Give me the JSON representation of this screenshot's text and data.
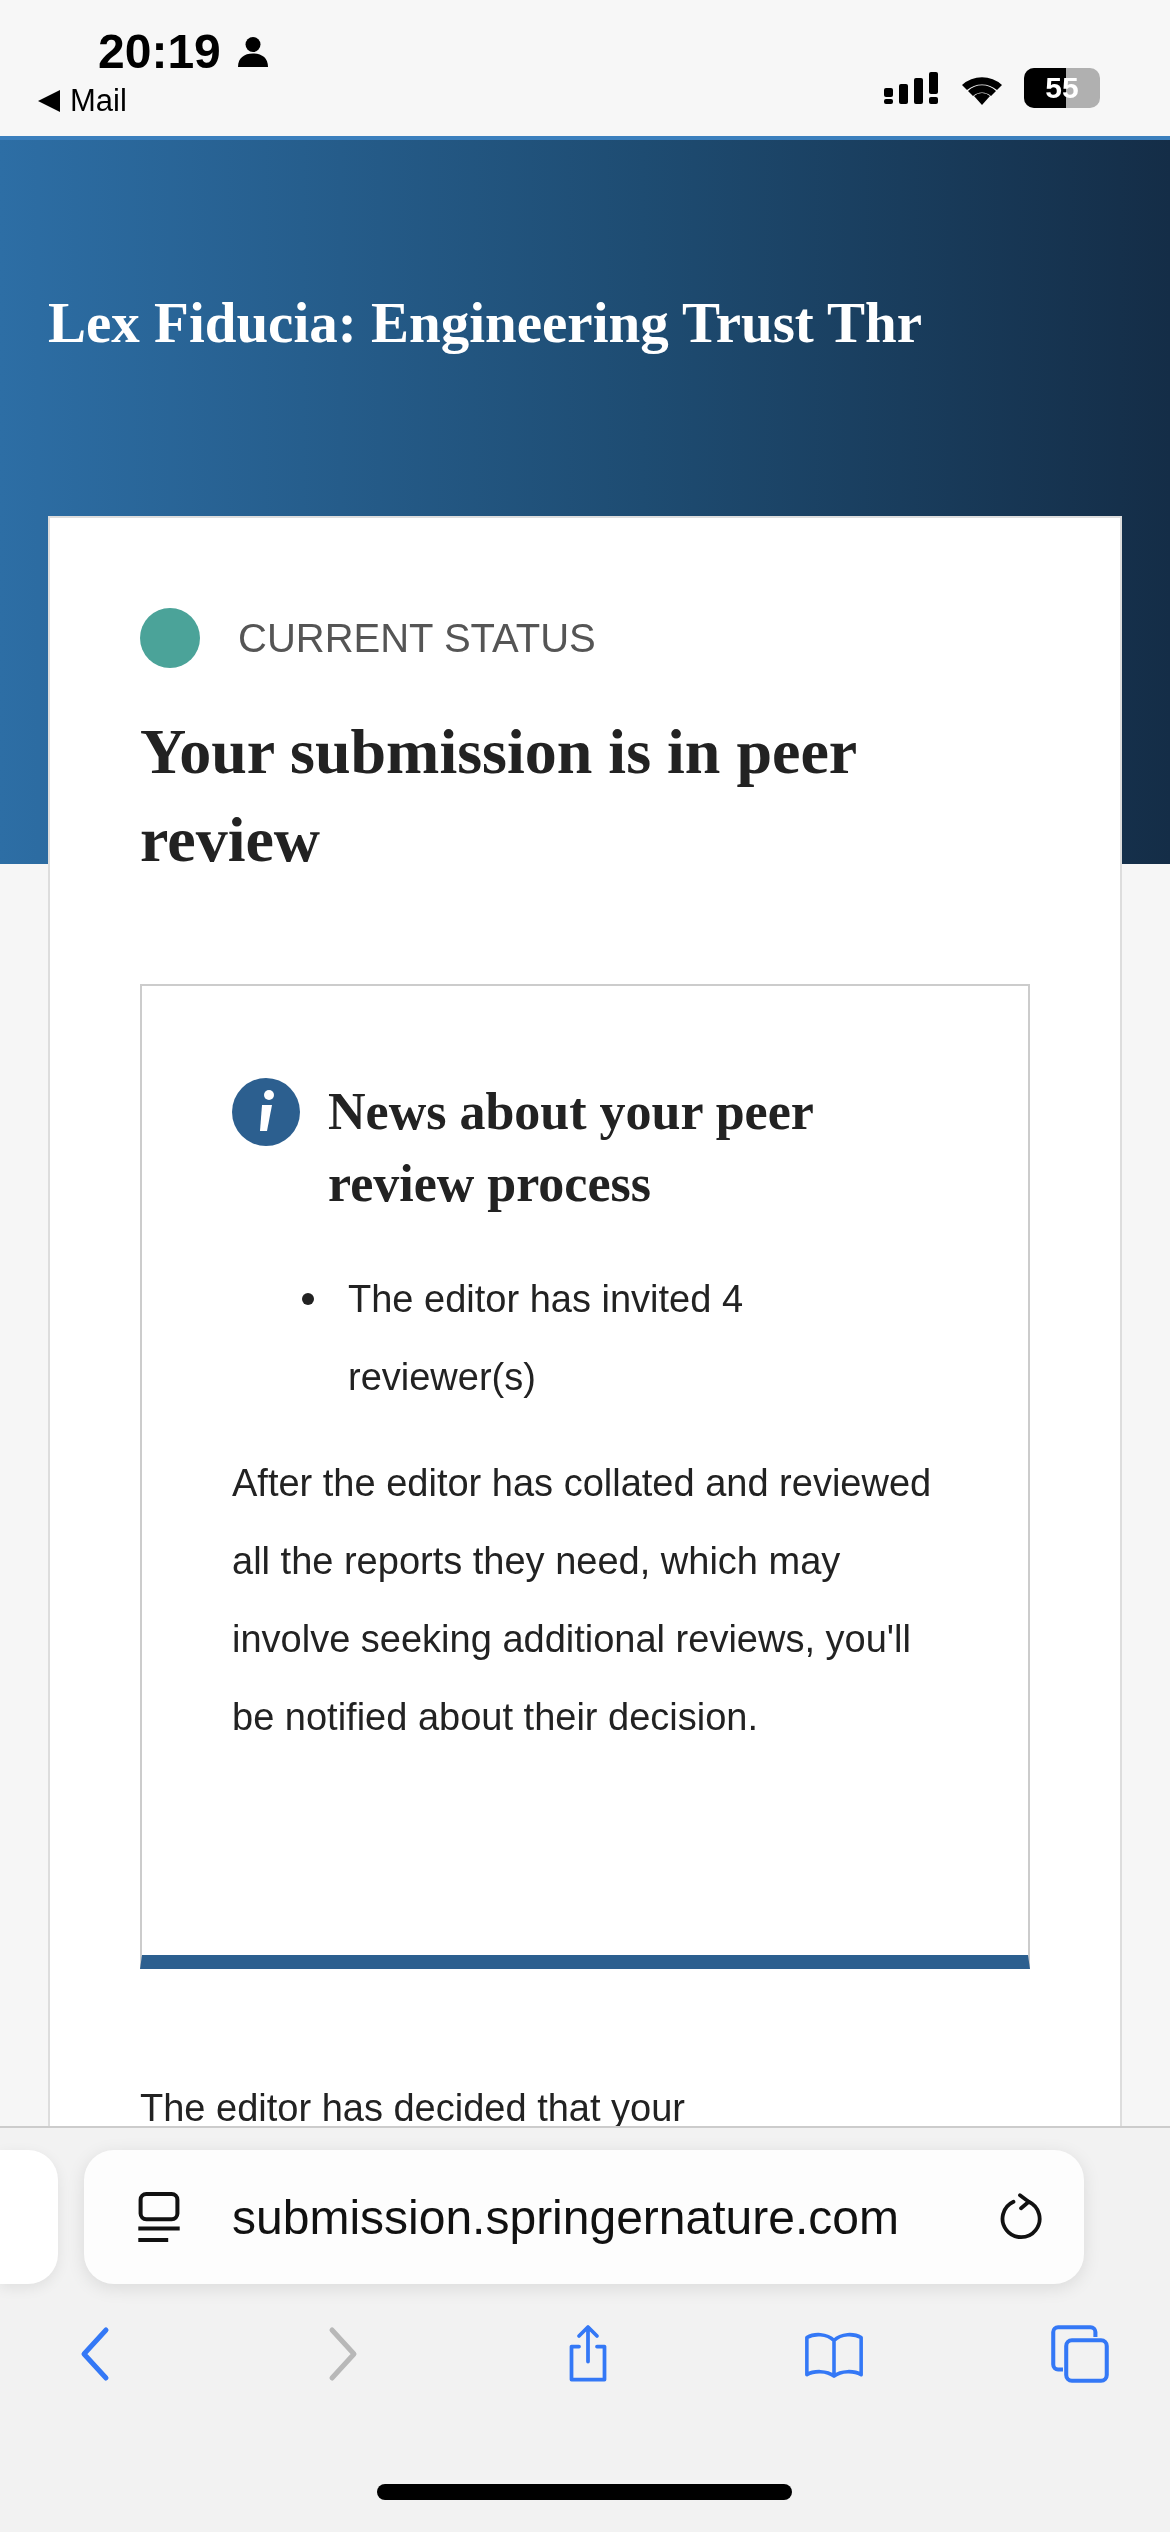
{
  "status_bar": {
    "time": "20:19",
    "back_app": "Mail",
    "battery": "55"
  },
  "header": {
    "title": "Lex Fiducia: Engineering Trust Thr"
  },
  "status_card": {
    "label": "CURRENT STATUS",
    "color": "#4ba399",
    "heading": "Your submission is in peer review",
    "news": {
      "title": "News about your peer review process",
      "bullets": [
        "The editor has invited 4 reviewer(s)"
      ],
      "paragraph": "After the editor has collated and reviewed all the reports they need, which may involve seeking additional reviews, you'll be notified about their decision."
    },
    "next_text": "The editor has decided that your"
  },
  "browser": {
    "url": "submission.springernature.com",
    "forward_disabled": true
  }
}
